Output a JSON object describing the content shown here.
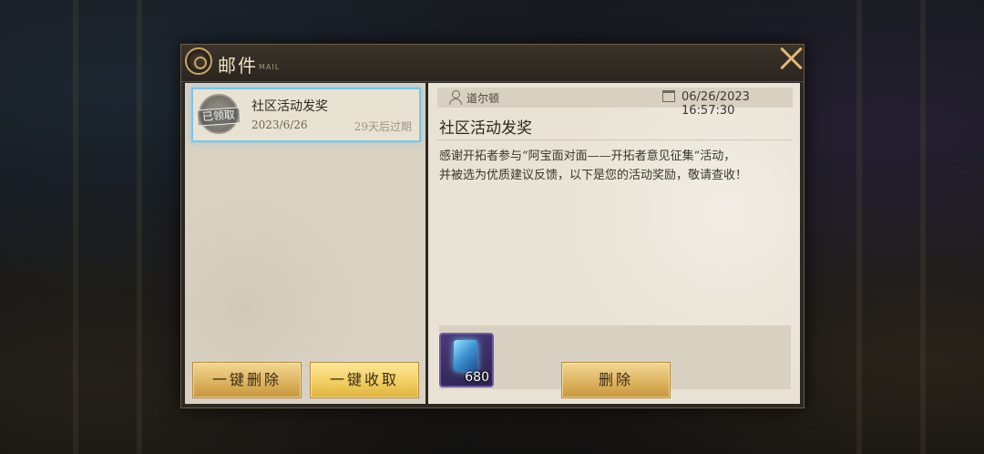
{
  "title": {
    "text": "邮件",
    "subtitle": "MAIL"
  },
  "mail_list": [
    {
      "title": "社区活动发奖",
      "date": "2023/6/26",
      "expire": "29天后过期",
      "stamp": "已领取"
    }
  ],
  "left_buttons": {
    "delete_all": "一键删除",
    "claim_all": "一键收取"
  },
  "detail": {
    "sender": "道尔顿",
    "timestamp": "06/26/2023 16:57:30",
    "title": "社区活动发奖",
    "body_line1": "感谢开拓者参与“阿宝面对面——开拓者意见征集”活动，",
    "body_line2": "并被选为优质建议反馈，以下是您的活动奖励，敬请查收！",
    "reward_count": "680",
    "delete_label": "删除"
  },
  "icons": {
    "close": "close-icon",
    "user": "user-icon",
    "calendar": "calendar-icon",
    "emblem": "mail-emblem-icon"
  },
  "colors": {
    "accent_gold": "#e0b879",
    "selection_blue": "#7cc4e6"
  }
}
